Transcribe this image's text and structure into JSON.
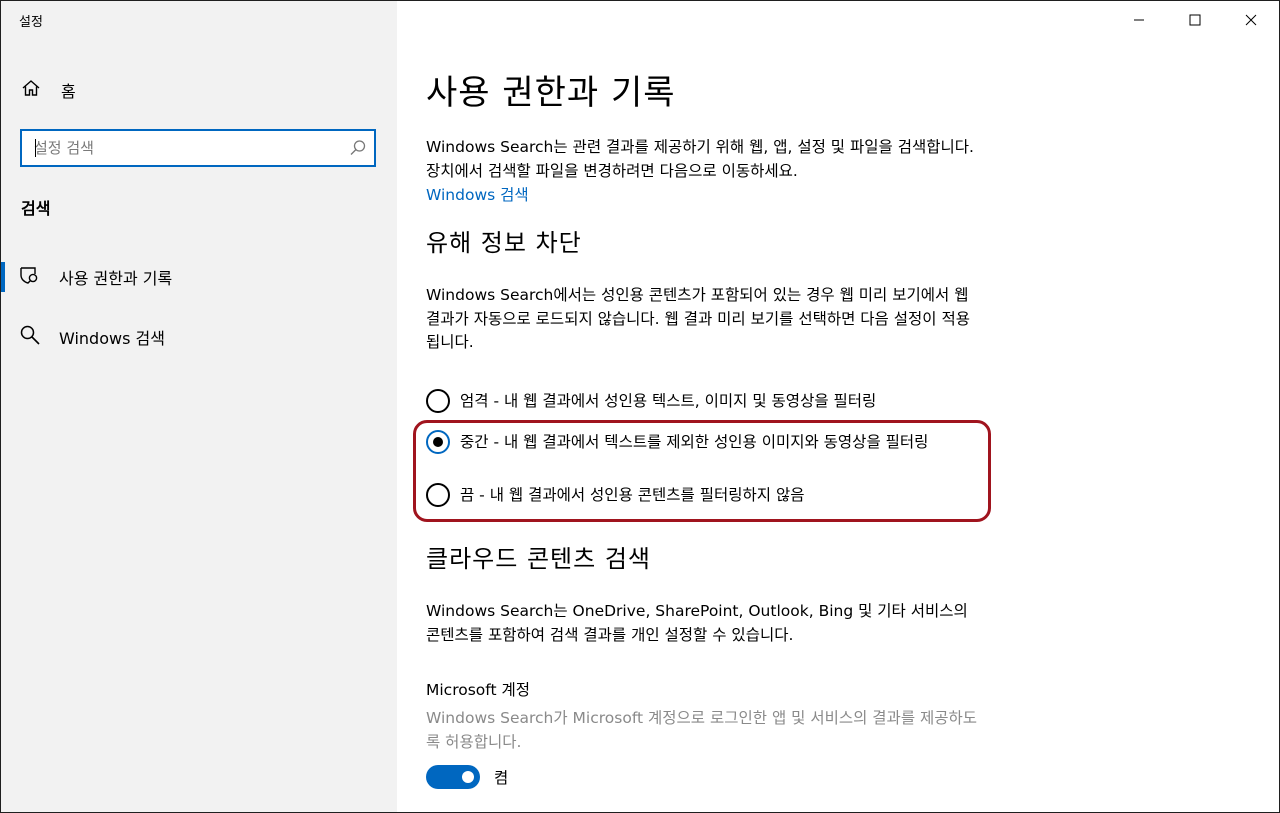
{
  "app": {
    "title": "설정"
  },
  "sidebar": {
    "home_label": "홈",
    "search_placeholder": "설정 검색",
    "section_label": "검색",
    "items": [
      {
        "label": "사용 권한과 기록",
        "icon": "shield-search-icon",
        "selected": true
      },
      {
        "label": "Windows 검색",
        "icon": "search-icon",
        "selected": false
      }
    ]
  },
  "main": {
    "title": "사용 권한과 기록",
    "intro": "Windows Search는 관련 결과를 제공하기 위해 웹, 앱, 설정 및 파일을 검색합니다. 장치에서 검색할 파일을 변경하려면 다음으로 이동하세요.",
    "intro_link": "Windows 검색",
    "safe_search": {
      "heading": "유해 정보 차단",
      "description": "Windows Search에서는 성인용 콘텐츠가 포함되어 있는 경우 웹 미리 보기에서 웹 결과가 자동으로 로드되지 않습니다. 웹 결과 미리 보기를 선택하면 다음 설정이 적용됩니다.",
      "options": [
        {
          "label": "엄격 - 내 웹 결과에서 성인용 텍스트, 이미지 및 동영상을 필터링",
          "checked": false
        },
        {
          "label": "중간 - 내 웹 결과에서 텍스트를 제외한 성인용 이미지와 동영상을 필터링",
          "checked": true
        },
        {
          "label": "끔 - 내 웹 결과에서 성인용 콘텐츠를 필터링하지 않음",
          "checked": false
        }
      ]
    },
    "cloud": {
      "heading": "클라우드 콘텐츠 검색",
      "description": "Windows Search는 OneDrive, SharePoint, Outlook, Bing 및 기타 서비스의 콘텐츠를 포함하여 검색 결과를 개인 설정할 수 있습니다.",
      "ms_account_label": "Microsoft 계정",
      "ms_account_desc": "Windows Search가 Microsoft 계정으로 로그인한 앱 및 서비스의 결과를 제공하도록 허용합니다.",
      "toggle_label": "켬",
      "toggle_on": true
    }
  },
  "colors": {
    "accent": "#0067c0",
    "highlight": "#a0141e",
    "sidebar_bg": "#f2f2f2"
  }
}
